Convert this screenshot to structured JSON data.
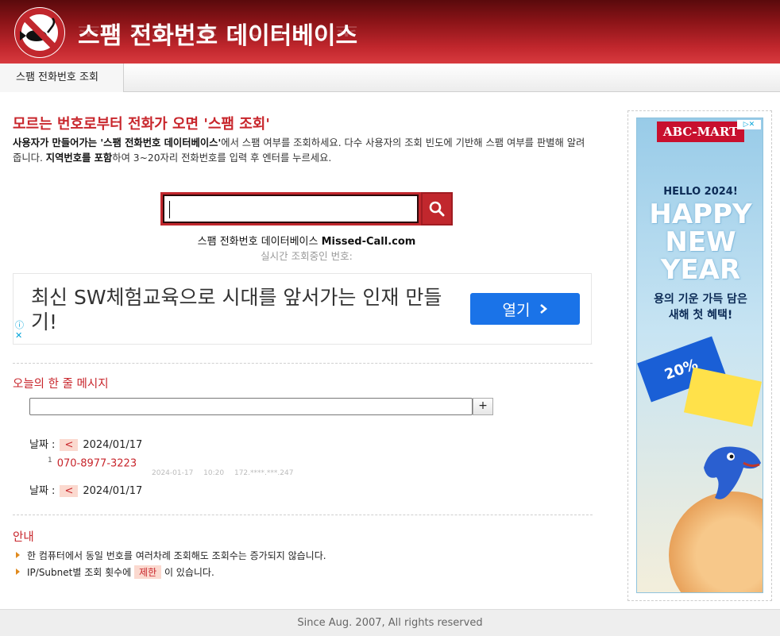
{
  "header": {
    "title": "스팸 전화번호 데이터베이스",
    "logo_icon": "no-fish-hook-logo"
  },
  "nav": {
    "tabs": [
      {
        "label": "스팸 전화번호 조회"
      }
    ]
  },
  "main": {
    "headline": "모르는 번호로부터 전화가 오면 '스팸 조회'",
    "desc": {
      "p1": "사용자가 만들어가는 ",
      "p2": "'스팸 전화번호 데이터베이스'",
      "p3": "에서 스팸 여부를 조회하세요. 다수 사용자의 조회 빈도에 기반해 스팸 여부를 판별해 알려줍니다. ",
      "p4": "지역번호를 포함",
      "p5": "하여 3~20자리 전화번호를 입력 후 엔터를 누르세요."
    },
    "search": {
      "value": "",
      "button_icon": "search-icon"
    },
    "site_line": {
      "prefix": "스팸 전화번호 데이터베이스 ",
      "domain": "Missed-Call.com"
    },
    "live_label": "실시간 조회중인 번호:",
    "ad": {
      "text": "최신 SW체험교육으로 시대를 앞서가는 인재 만들기!",
      "button": "열기"
    }
  },
  "message": {
    "title_a": "오늘의 ",
    "title_b": "한 줄",
    "title_c": " 메시지",
    "add_label": "+",
    "date_label": "날짜 :",
    "prev": "<",
    "date1": "2024/01/17",
    "date2": "2024/01/17",
    "entry_num": "1",
    "entry_phone": "070-8977-3223",
    "entry_time": "2024-01-17 10:20",
    "entry_ip": "172.****.***.247"
  },
  "notice": {
    "title": "안내",
    "item1": "한 컴퓨터에서 동일 번호를 여러차례 조회해도 조회수는 증가되지 않습니다.",
    "item2_a": "IP/Subnet별 조회 횟수에 ",
    "item2_b": "제한",
    "item2_c": " 이 있습니다."
  },
  "side_ad": {
    "brand": "ABC-MART",
    "hello": "HELLO 2024!",
    "happy": "HAPPY NEW YEAR",
    "sub1": "용의 기운 가득 담은",
    "sub2": "새해 첫 혜택!",
    "coupon": "20%"
  },
  "footer": {
    "text": "Since Aug. 2007, All rights reserved"
  },
  "colors": {
    "brand_red": "#c1272d",
    "accent_red": "#c8262c",
    "ad_blue": "#1a73e8"
  }
}
